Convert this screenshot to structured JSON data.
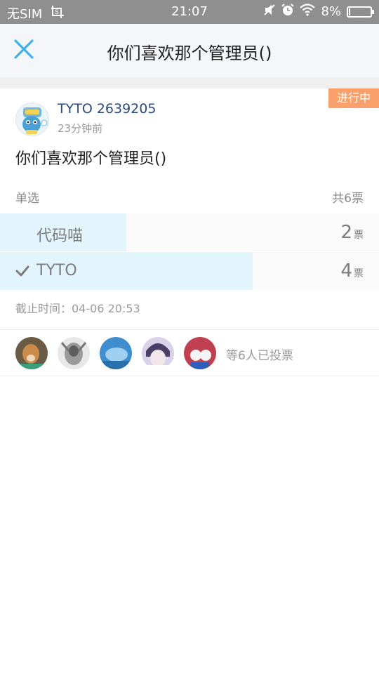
{
  "status_bar": {
    "carrier": "无SIM",
    "time": "21:07",
    "battery": "8%",
    "battery_level": 0.08,
    "icons": [
      "screenshot-icon",
      "mute-icon",
      "alarm-icon",
      "wifi-icon",
      "battery-icon"
    ]
  },
  "header": {
    "title": "你们喜欢那个管理员()",
    "close_icon": "close-icon",
    "accent_color": "#3db1e8"
  },
  "post": {
    "status": "进行中",
    "author": "TYTO  2639205",
    "time": "23分钟前",
    "title": "你们喜欢那个管理员()"
  },
  "poll": {
    "type": "单选",
    "total": "共6票",
    "options": [
      {
        "label": "代码喵",
        "count": "2",
        "unit": "票",
        "fraction": 0.333,
        "selected": false
      },
      {
        "label": "TYTO",
        "count": "4",
        "unit": "票",
        "fraction": 0.667,
        "selected": true
      }
    ],
    "deadline": "截止时间：04-06 20:53"
  },
  "voters": {
    "summary": "等6人已投票",
    "count_shown": 5
  }
}
